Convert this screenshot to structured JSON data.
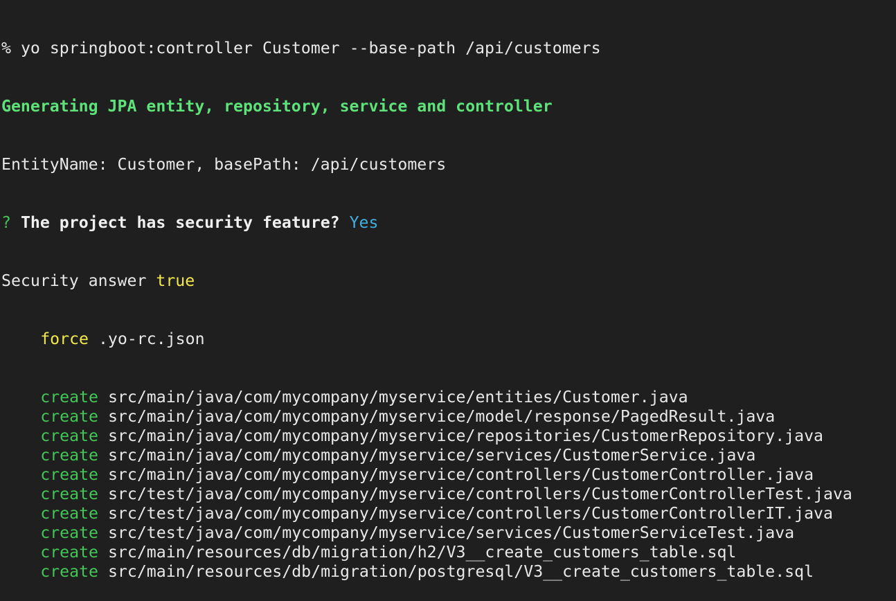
{
  "terminal": {
    "prompt_symbol": "%",
    "command": "yo springboot:controller Customer --base-path /api/customers",
    "generating_message": "Generating JPA entity, repository, service and controller",
    "entity_info": "EntityName: Customer, basePath: /api/customers",
    "question_mark": "?",
    "question": "The project has security feature?",
    "answer": "Yes",
    "security_label": "Security answer",
    "security_value": "true",
    "force_op": "force",
    "force_file": ".yo-rc.json",
    "create_op": "create",
    "created_files": [
      "src/main/java/com/mycompany/myservice/entities/Customer.java",
      "src/main/java/com/mycompany/myservice/model/response/PagedResult.java",
      "src/main/java/com/mycompany/myservice/repositories/CustomerRepository.java",
      "src/main/java/com/mycompany/myservice/services/CustomerService.java",
      "src/main/java/com/mycompany/myservice/controllers/CustomerController.java",
      "src/test/java/com/mycompany/myservice/controllers/CustomerControllerTest.java",
      "src/test/java/com/mycompany/myservice/controllers/CustomerControllerIT.java",
      "src/test/java/com/mycompany/myservice/services/CustomerServiceTest.java",
      "src/main/resources/db/migration/h2/V3__create_customers_table.sql",
      "src/main/resources/db/migration/postgresql/V3__create_customers_table.sql"
    ]
  },
  "colors": {
    "background": "#1f1f1f",
    "text": "#e8e8e8",
    "green_bold": "#5ee27a",
    "green": "#43c657",
    "yellow": "#f2e84b",
    "cyan": "#3fb0e0"
  }
}
